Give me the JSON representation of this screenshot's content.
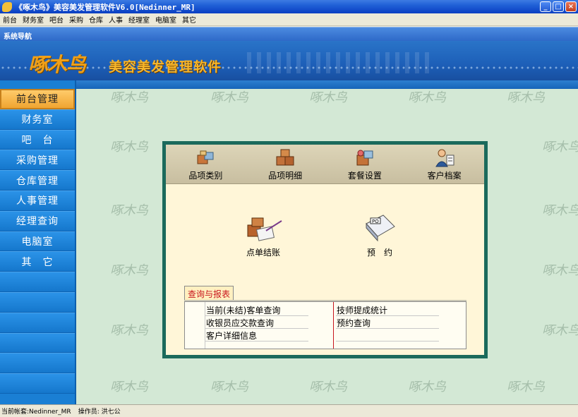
{
  "window": {
    "title": "《啄木鸟》美容美发管理软件V6.0[Nedinner_MR]",
    "controls": {
      "minimize": "_",
      "maximize": "□",
      "close": "×"
    }
  },
  "menu": [
    "前台",
    "财务室",
    "吧台",
    "采购",
    "仓库",
    "人事",
    "经理室",
    "电脑室",
    "其它"
  ],
  "nav_title": "系统导航",
  "banner": {
    "logo": "啄木鸟",
    "brand": "美容美发管理软件"
  },
  "sidebar": {
    "items": [
      "前台管理",
      "财务室",
      "吧　台",
      "采购管理",
      "仓库管理",
      "人事管理",
      "经理查询",
      "电脑室",
      "其　它"
    ],
    "active_index": 0
  },
  "watermark": "啄木鸟",
  "panel": {
    "tools": [
      {
        "label": "品项类别",
        "icon": "category-icon"
      },
      {
        "label": "品项明细",
        "icon": "boxes-icon"
      },
      {
        "label": "套餐设置",
        "icon": "package-icon"
      },
      {
        "label": "客户档案",
        "icon": "customer-icon"
      }
    ],
    "actions": [
      {
        "label": "点单结账",
        "icon": "checkout-icon"
      },
      {
        "label": "预　约",
        "icon": "booking-icon"
      }
    ],
    "report": {
      "tab": "查询与报表",
      "left": [
        "当前(未结)客单查询",
        "收银员应交款查询",
        "客户详细信息"
      ],
      "right": [
        "技师提成统计",
        "预约查询"
      ]
    }
  },
  "status": {
    "account": "当前帐套:Nedinner_MR",
    "operator": "操作员: 洪七公"
  },
  "colors": {
    "accent": "#1a7fd4",
    "active": "#f0a531",
    "panel_border": "#1b6a5c",
    "tab_text": "#c8161d"
  }
}
